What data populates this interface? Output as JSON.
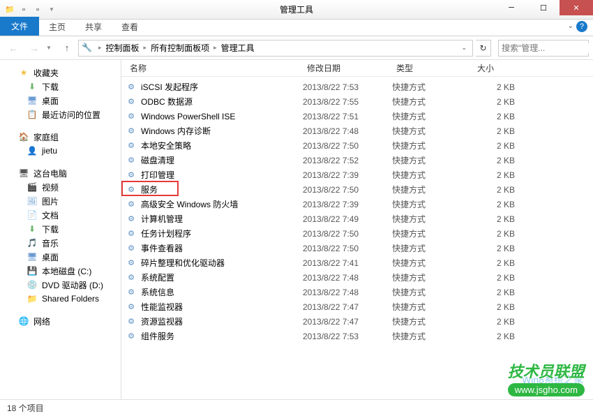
{
  "titlebar": {
    "title": "管理工具"
  },
  "ribbon": {
    "file": "文件",
    "home": "主页",
    "share": "共享",
    "view": "查看"
  },
  "breadcrumb": {
    "c1": "控制面板",
    "c2": "所有控制面板项",
    "c3": "管理工具"
  },
  "search": {
    "placeholder": "搜索\"管理..."
  },
  "sidebar": {
    "favorites": "收藏夹",
    "downloads": "下载",
    "desktop": "桌面",
    "recent": "最近访问的位置",
    "homegroup": "家庭组",
    "user": "jietu",
    "thispc": "这台电脑",
    "videos": "视频",
    "pictures": "图片",
    "documents": "文档",
    "downloads2": "下载",
    "music": "音乐",
    "desktop2": "桌面",
    "localdisk": "本地磁盘 (C:)",
    "dvd": "DVD 驱动器 (D:)",
    "shared": "Shared Folders",
    "network": "网络"
  },
  "columns": {
    "name": "名称",
    "date": "修改日期",
    "type": "类型",
    "size": "大小"
  },
  "files": [
    {
      "name": "iSCSI 发起程序",
      "date": "2013/8/22 7:53",
      "type": "快捷方式",
      "size": "2 KB"
    },
    {
      "name": "ODBC 数据源",
      "date": "2013/8/22 7:55",
      "type": "快捷方式",
      "size": "2 KB"
    },
    {
      "name": "Windows PowerShell ISE",
      "date": "2013/8/22 7:51",
      "type": "快捷方式",
      "size": "2 KB"
    },
    {
      "name": "Windows 内存诊断",
      "date": "2013/8/22 7:48",
      "type": "快捷方式",
      "size": "2 KB"
    },
    {
      "name": "本地安全策略",
      "date": "2013/8/22 7:50",
      "type": "快捷方式",
      "size": "2 KB"
    },
    {
      "name": "磁盘清理",
      "date": "2013/8/22 7:52",
      "type": "快捷方式",
      "size": "2 KB"
    },
    {
      "name": "打印管理",
      "date": "2013/8/22 7:39",
      "type": "快捷方式",
      "size": "2 KB"
    },
    {
      "name": "服务",
      "date": "2013/8/22 7:50",
      "type": "快捷方式",
      "size": "2 KB",
      "highlight": true
    },
    {
      "name": "高级安全 Windows 防火墙",
      "date": "2013/8/22 7:39",
      "type": "快捷方式",
      "size": "2 KB"
    },
    {
      "name": "计算机管理",
      "date": "2013/8/22 7:49",
      "type": "快捷方式",
      "size": "2 KB"
    },
    {
      "name": "任务计划程序",
      "date": "2013/8/22 7:50",
      "type": "快捷方式",
      "size": "2 KB"
    },
    {
      "name": "事件查看器",
      "date": "2013/8/22 7:50",
      "type": "快捷方式",
      "size": "2 KB"
    },
    {
      "name": "碎片整理和优化驱动器",
      "date": "2013/8/22 7:41",
      "type": "快捷方式",
      "size": "2 KB"
    },
    {
      "name": "系统配置",
      "date": "2013/8/22 7:48",
      "type": "快捷方式",
      "size": "2 KB"
    },
    {
      "name": "系统信息",
      "date": "2013/8/22 7:48",
      "type": "快捷方式",
      "size": "2 KB"
    },
    {
      "name": "性能监视器",
      "date": "2013/8/22 7:47",
      "type": "快捷方式",
      "size": "2 KB"
    },
    {
      "name": "资源监视器",
      "date": "2013/8/22 7:47",
      "type": "快捷方式",
      "size": "2 KB"
    },
    {
      "name": "组件服务",
      "date": "2013/8/22 7:53",
      "type": "快捷方式",
      "size": "2 KB"
    }
  ],
  "statusbar": {
    "count": "18 个项目"
  },
  "watermark": {
    "top": "技术员联盟",
    "bot": "www.jsgho.com",
    "logo": "Win8系统之家"
  }
}
